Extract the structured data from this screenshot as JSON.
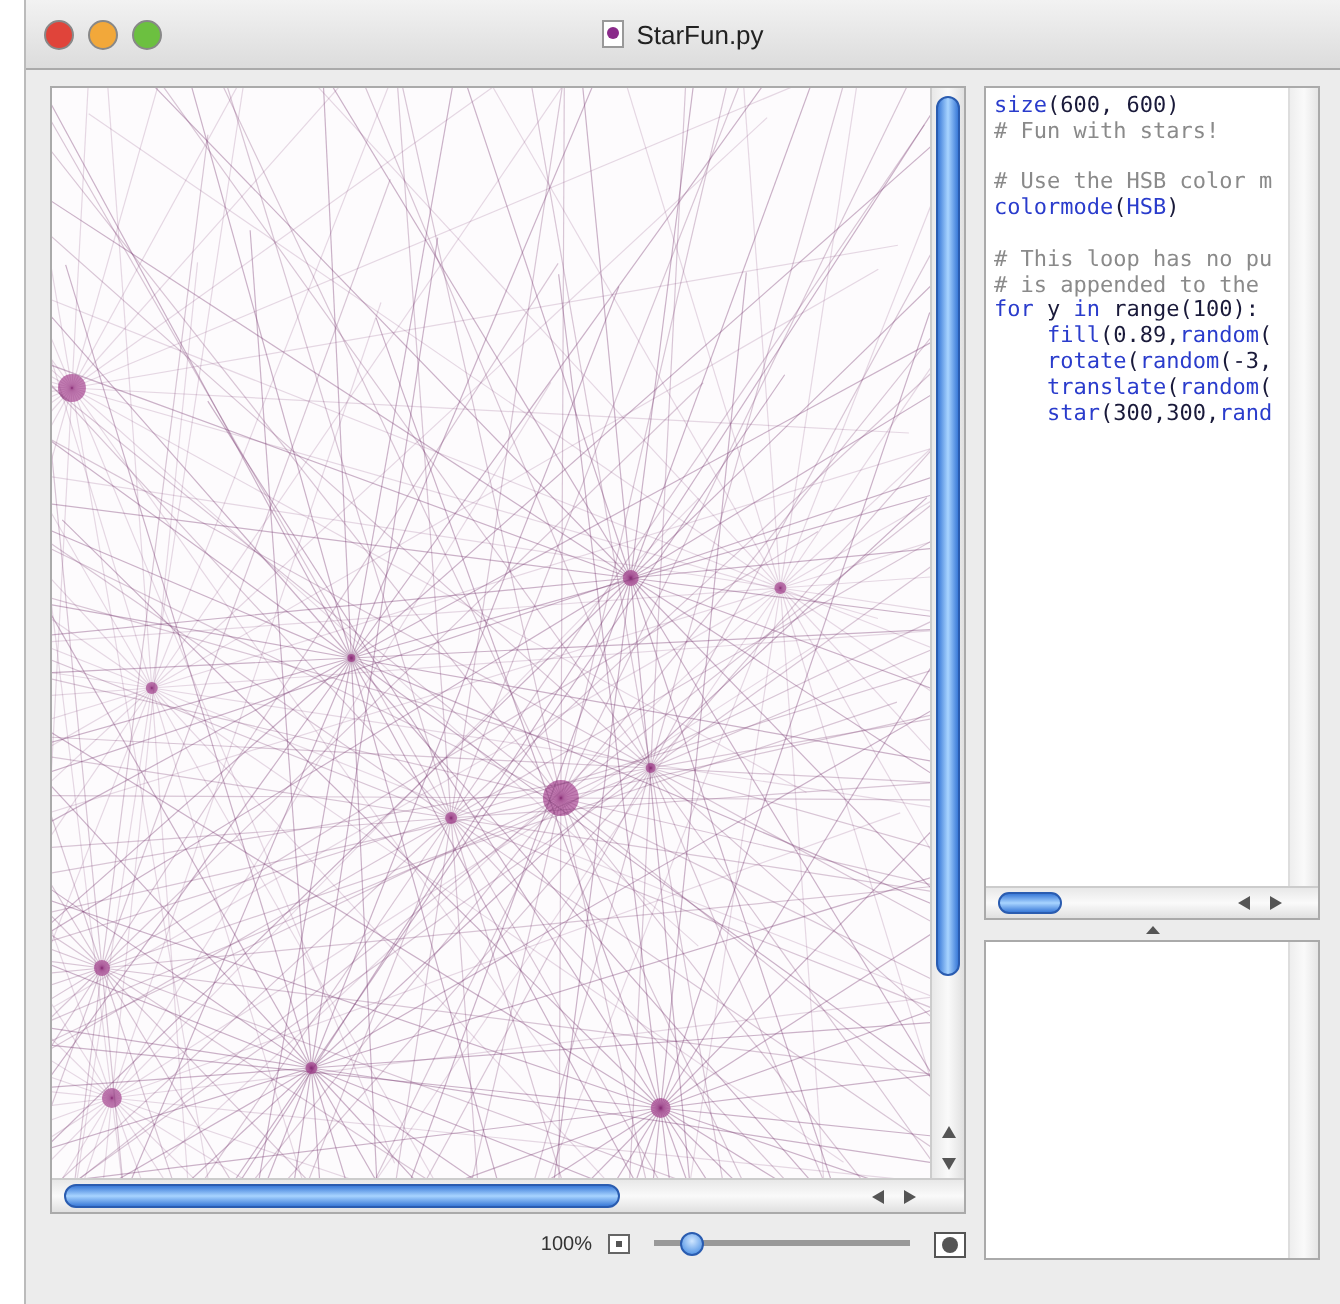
{
  "window": {
    "title": "StarFun.py"
  },
  "code": [
    {
      "kind": "code",
      "tokens": [
        {
          "text": "size",
          "kind": "func"
        },
        {
          "text": "(600, 600)",
          "kind": "plain"
        }
      ]
    },
    {
      "kind": "code",
      "tokens": [
        {
          "text": "# Fun with stars!",
          "kind": "comment"
        }
      ]
    },
    {
      "kind": "blank"
    },
    {
      "kind": "code",
      "tokens": [
        {
          "text": "# Use the HSB color m",
          "kind": "comment"
        }
      ]
    },
    {
      "kind": "code",
      "tokens": [
        {
          "text": "colormode",
          "kind": "func"
        },
        {
          "text": "(",
          "kind": "plain"
        },
        {
          "text": "HSB",
          "kind": "func"
        },
        {
          "text": ")",
          "kind": "plain"
        }
      ]
    },
    {
      "kind": "blank"
    },
    {
      "kind": "code",
      "tokens": [
        {
          "text": "# This loop has no pu",
          "kind": "comment"
        }
      ]
    },
    {
      "kind": "code",
      "tokens": [
        {
          "text": "# is appended to the",
          "kind": "comment"
        }
      ]
    },
    {
      "kind": "code",
      "tokens": [
        {
          "text": "for",
          "kind": "keyword"
        },
        {
          "text": " y ",
          "kind": "plain"
        },
        {
          "text": "in",
          "kind": "keyword"
        },
        {
          "text": " range(100):",
          "kind": "plain"
        }
      ]
    },
    {
      "kind": "code",
      "tokens": [
        {
          "text": "    fill",
          "kind": "func"
        },
        {
          "text": "(0.89,",
          "kind": "plain"
        },
        {
          "text": "random",
          "kind": "func"
        },
        {
          "text": "(",
          "kind": "plain"
        }
      ]
    },
    {
      "kind": "code",
      "tokens": [
        {
          "text": "    rotate",
          "kind": "func"
        },
        {
          "text": "(",
          "kind": "plain"
        },
        {
          "text": "random",
          "kind": "func"
        },
        {
          "text": "(-3,",
          "kind": "plain"
        }
      ]
    },
    {
      "kind": "code",
      "tokens": [
        {
          "text": "    translate",
          "kind": "func"
        },
        {
          "text": "(",
          "kind": "plain"
        },
        {
          "text": "random",
          "kind": "func"
        },
        {
          "text": "(",
          "kind": "plain"
        }
      ]
    },
    {
      "kind": "code",
      "tokens": [
        {
          "text": "    star",
          "kind": "func"
        },
        {
          "text": "(300,300,",
          "kind": "plain"
        },
        {
          "text": "rand",
          "kind": "func"
        }
      ]
    }
  ],
  "zoom": {
    "label": "100%",
    "level": 0.15
  }
}
